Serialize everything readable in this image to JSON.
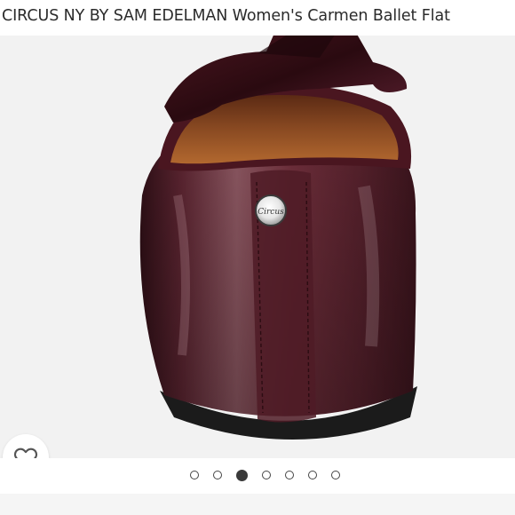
{
  "product": {
    "title": "CIRCUS NY BY SAM EDELMAN Women's Carmen Ballet Flat",
    "image_description_icon": "product-photo",
    "logo_text": "Circus"
  },
  "wishlist": {
    "icon": "heart-outline-icon"
  },
  "carousel": {
    "total": 7,
    "active_index": 2
  },
  "colors": {
    "shoe": "#5a1f2a",
    "background": "#f2f2f2",
    "dot_active": "#3a3a3a"
  }
}
